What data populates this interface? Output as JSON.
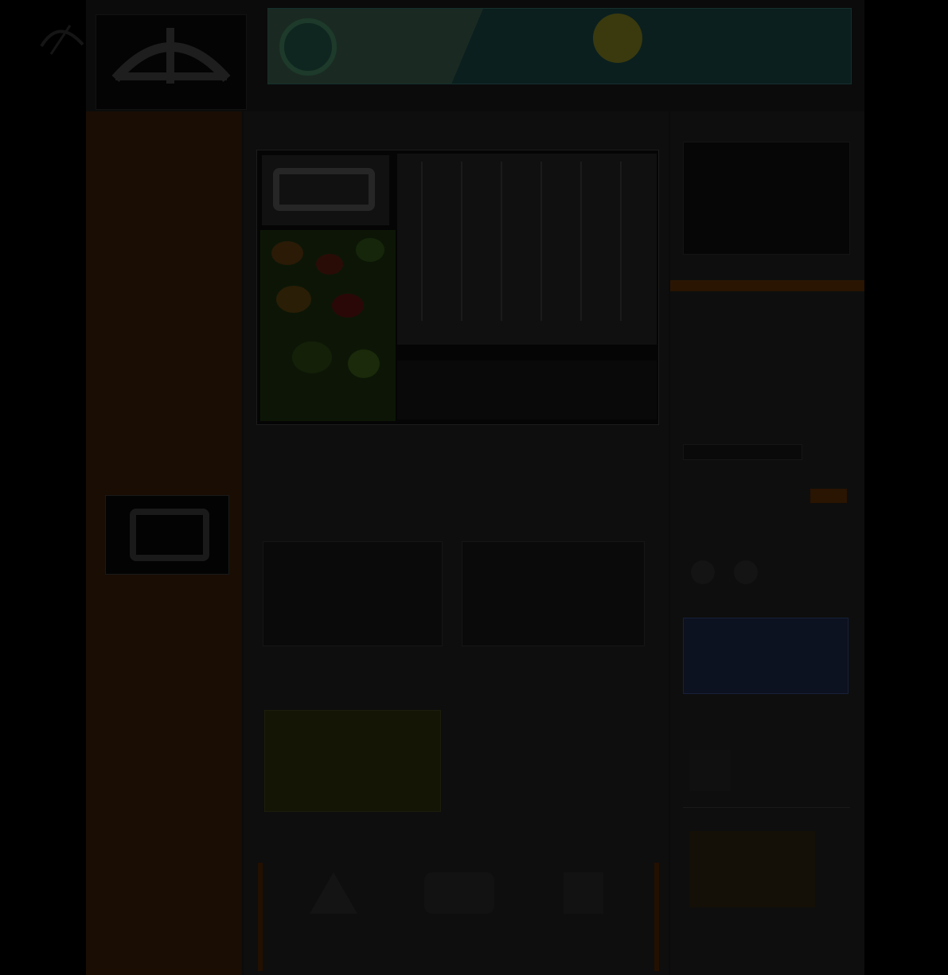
{
  "colors": {
    "accent_orange": "#3a1b05",
    "sidebar_brown": "#1a0d03",
    "page_bg": "#000000"
  },
  "header": {
    "logo_text": "",
    "banner": {
      "title": "",
      "middle": "",
      "right": "",
      "cta": ""
    },
    "nav": []
  },
  "sidebar": {
    "items": []
  },
  "main": {
    "breadcrumb": "",
    "hero_caption": "",
    "hero_description": "",
    "section_title": "",
    "thumbs": [
      {
        "caption": ""
      },
      {
        "caption": ""
      }
    ],
    "promo": {
      "image_text": "",
      "title": "",
      "description": ""
    },
    "brands_title": "",
    "brands": [
      {
        "name": "",
        "sub": ""
      },
      {
        "name": "",
        "sub": ""
      },
      {
        "name": "",
        "sub": ""
      }
    ]
  },
  "right": {
    "calendar_title": "",
    "calendar_month": "",
    "calendar_days": [],
    "links": [],
    "search_placeholder": "",
    "search_button": "",
    "follow_title": "",
    "ad_text": "",
    "news_title": "",
    "news_text": "",
    "news_title2": "",
    "footer_text": ""
  }
}
